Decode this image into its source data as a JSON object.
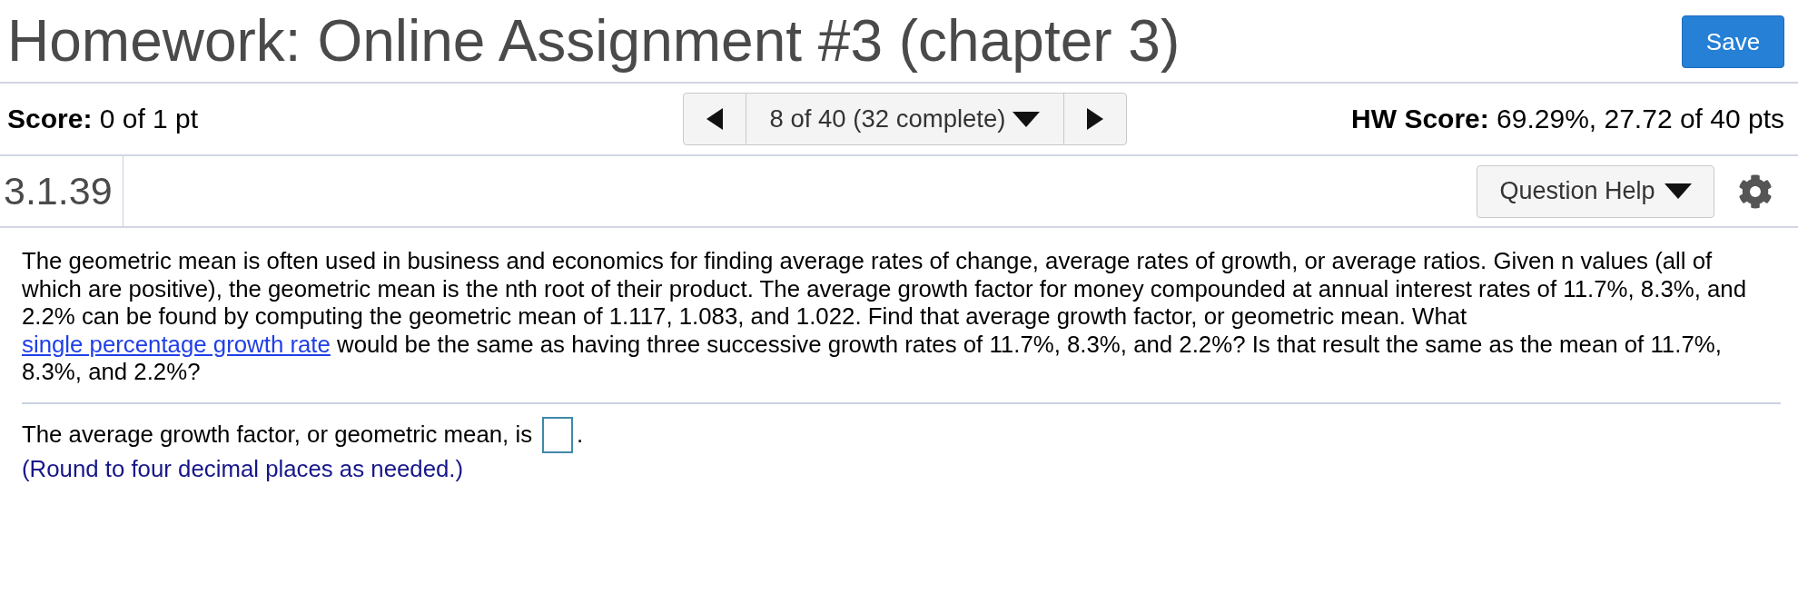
{
  "header": {
    "title": "Homework: Online Assignment #3 (chapter 3)",
    "save_button": "Save"
  },
  "score_bar": {
    "score": "**Score:** 0 of 1 pt",
    "navigator": {
      "position": "8 of 40 (32 complete)"
    },
    "hw_score": "**HW Score:** 69.29%, 27.72 of 40 pts"
  },
  "question_bar": {
    "number": "3.1.39",
    "help_button": "Question Help"
  },
  "question": {
    "parts": [
      {
        "kind": "text",
        "text": "The geometric mean is often used in business and economics for finding average rates of change, average rates of growth, or average ratios. Given n values (all of which are positive), the geometric mean is the nth root of their product. The average growth factor for money compounded at annual interest rates of 11.7%, 8.3%, and 2.2% can be found by computing the geometric mean of 1.117, 1.083, and 1.022. Find that average growth factor, or geometric mean. What "
      },
      {
        "kind": "link",
        "text": "single percentage growth rate"
      },
      {
        "kind": "text",
        "text": " would be the same as having three successive growth rates of 11.7%, 8.3%, and 2.2%? Is that result the same as the mean of 11.7%, 8.3%, and 2.2%?"
      }
    ]
  },
  "answer": {
    "prompt": "The average growth factor, or geometric mean, is",
    "end": ".",
    "hint": "(Round to four decimal places as needed.)"
  }
}
